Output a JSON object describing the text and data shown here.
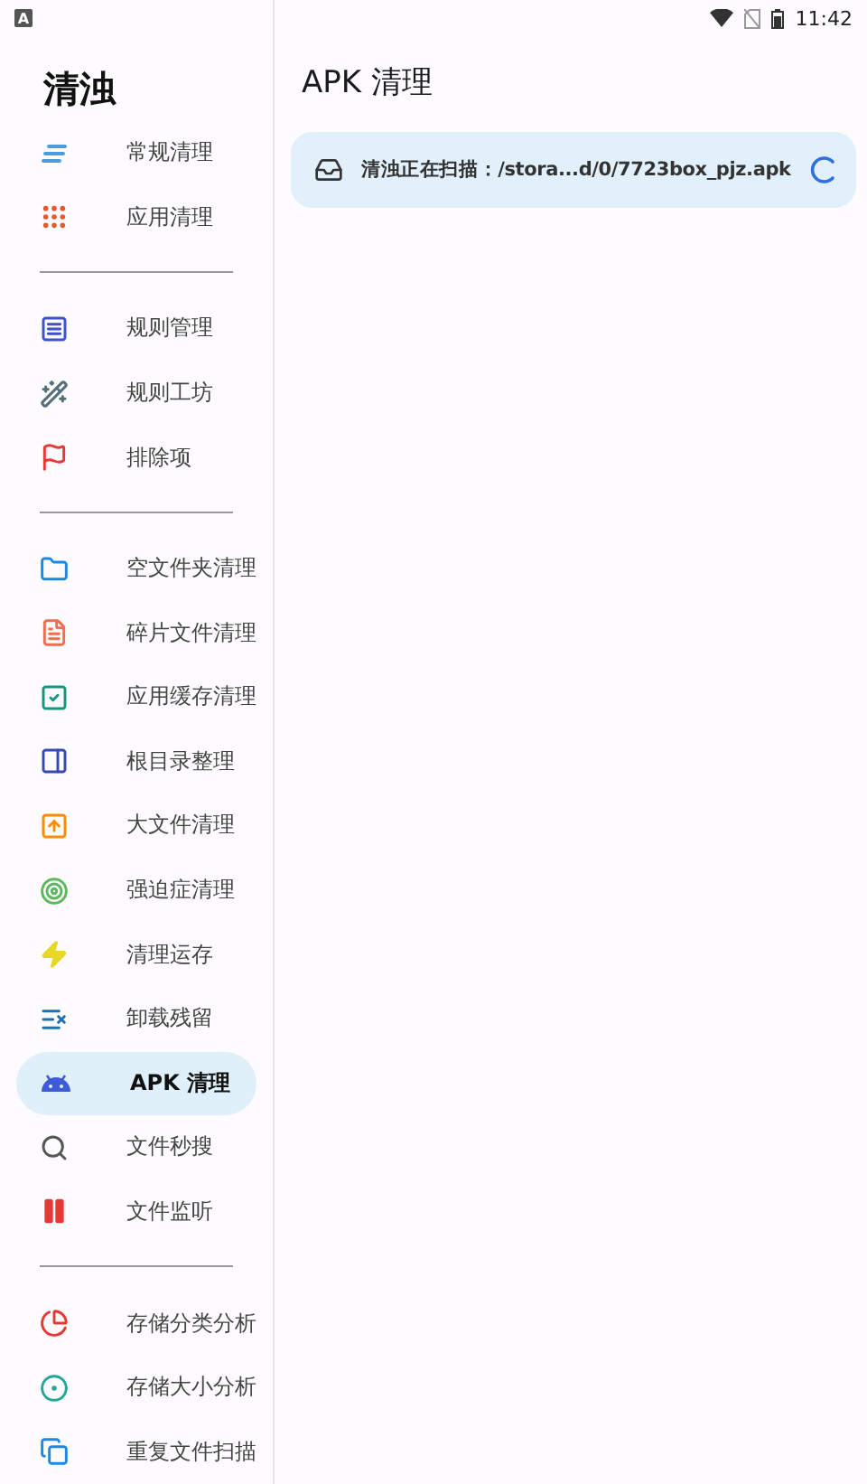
{
  "status_bar": {
    "notification": "A",
    "time": "11:42"
  },
  "sidebar": {
    "title": "清浊",
    "groups": [
      {
        "items": [
          {
            "label": "常规清理",
            "selected": false
          },
          {
            "label": "应用清理",
            "selected": false
          }
        ]
      },
      {
        "items": [
          {
            "label": "规则管理",
            "selected": false
          },
          {
            "label": "规则工坊",
            "selected": false
          },
          {
            "label": "排除项",
            "selected": false
          }
        ]
      },
      {
        "items": [
          {
            "label": "空文件夹清理",
            "selected": false
          },
          {
            "label": "碎片文件清理",
            "selected": false
          },
          {
            "label": "应用缓存清理",
            "selected": false
          },
          {
            "label": "根目录整理",
            "selected": false
          },
          {
            "label": "大文件清理",
            "selected": false
          },
          {
            "label": "强迫症清理",
            "selected": false
          },
          {
            "label": "清理运存",
            "selected": false
          },
          {
            "label": "卸载残留",
            "selected": false
          },
          {
            "label": "APK 清理",
            "selected": true
          },
          {
            "label": "文件秒搜",
            "selected": false
          },
          {
            "label": "文件监听",
            "selected": false
          }
        ]
      },
      {
        "items": [
          {
            "label": "存储分类分析",
            "selected": false
          },
          {
            "label": "存储大小分析",
            "selected": false
          },
          {
            "label": "重复文件扫描",
            "selected": false
          }
        ]
      }
    ]
  },
  "main": {
    "title": "APK 清理",
    "scan_card": {
      "text": "清浊正在扫描：/stora...d/0/7723box_pjz.apk"
    }
  }
}
